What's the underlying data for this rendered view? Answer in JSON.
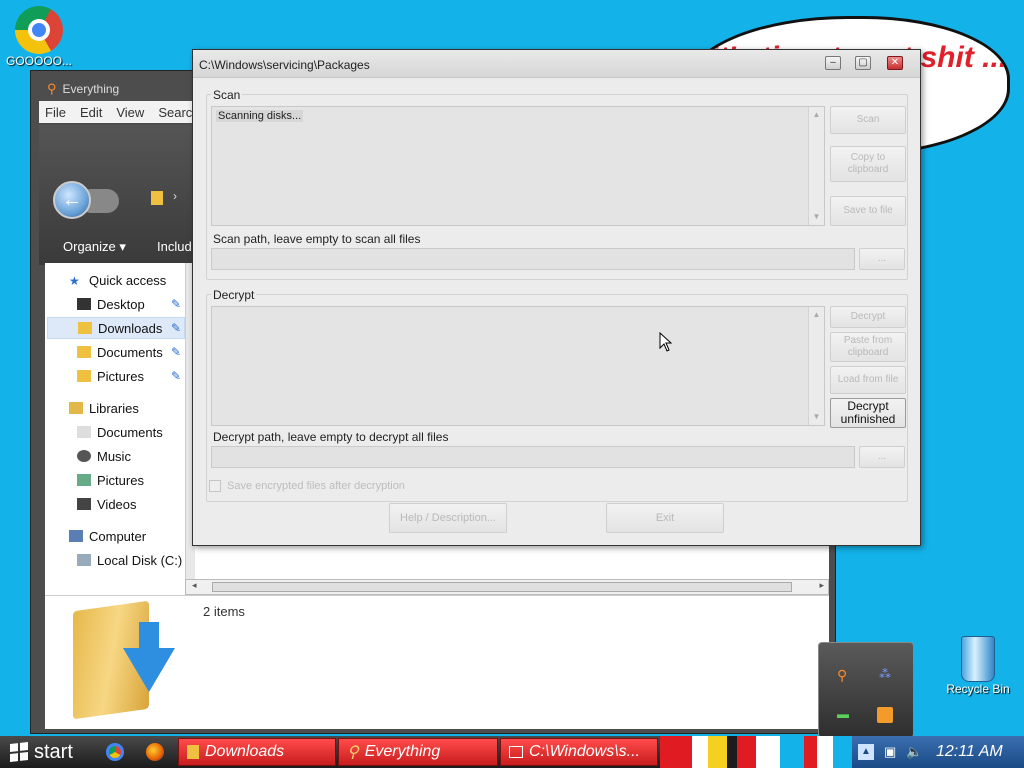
{
  "desktop": {
    "chrome_label": "GOOOOO...",
    "recycle_label": "Recycle Bin",
    "bubble_text": "it's time to get shit ... ew"
  },
  "explorer": {
    "title": "Everything",
    "menu": [
      "File",
      "Edit",
      "View",
      "Searc"
    ],
    "organize_label": "Organize ▾",
    "include_label": "Includ",
    "nav_items": [
      {
        "label": "Quick access",
        "icon": "star-icon"
      },
      {
        "label": "Desktop",
        "icon": "desktop-icon",
        "pinned": true
      },
      {
        "label": "Downloads",
        "icon": "downloads-folder-icon",
        "pinned": true,
        "selected": true
      },
      {
        "label": "Documents",
        "icon": "documents-icon",
        "pinned": true
      },
      {
        "label": "Pictures",
        "icon": "pictures-icon",
        "pinned": true
      },
      {
        "label": "Libraries",
        "icon": "libraries-icon"
      },
      {
        "label": "Documents",
        "icon": "documents-icon"
      },
      {
        "label": "Music",
        "icon": "music-icon"
      },
      {
        "label": "Pictures",
        "icon": "pictures-icon"
      },
      {
        "label": "Videos",
        "icon": "videos-icon"
      },
      {
        "label": "Computer",
        "icon": "computer-icon"
      },
      {
        "label": "Local Disk (C:)",
        "icon": "disk-icon"
      }
    ],
    "items_count": "2 items"
  },
  "dialog": {
    "title": "C:\\Windows\\servicing\\Packages",
    "scan_group": "Scan",
    "scan_output": "Scanning disks...",
    "scan_buttons": {
      "scan": "Scan",
      "copy": "Copy to clipboard",
      "save": "Save to file"
    },
    "scan_path_label": "Scan path, leave empty to scan all files",
    "browse_label": "...",
    "decrypt_group": "Decrypt",
    "decrypt_buttons": {
      "decrypt": "Decrypt",
      "paste": "Paste from clipboard",
      "load": "Load from file",
      "unfinished": "Decrypt unfinished"
    },
    "decrypt_path_label": "Decrypt path, leave empty to decrypt all files",
    "checkbox_label": "Save encrypted files after decryption",
    "help_button": "Help / Description...",
    "exit_button": "Exit"
  },
  "taskbar": {
    "start_label": "start",
    "tasks": [
      {
        "label": "Downloads",
        "icon": "folder-icon"
      },
      {
        "label": "Everything",
        "icon": "search-icon"
      },
      {
        "label": "C:\\Windows\\s...",
        "icon": "window-icon"
      }
    ],
    "clock": "12:11 AM"
  }
}
